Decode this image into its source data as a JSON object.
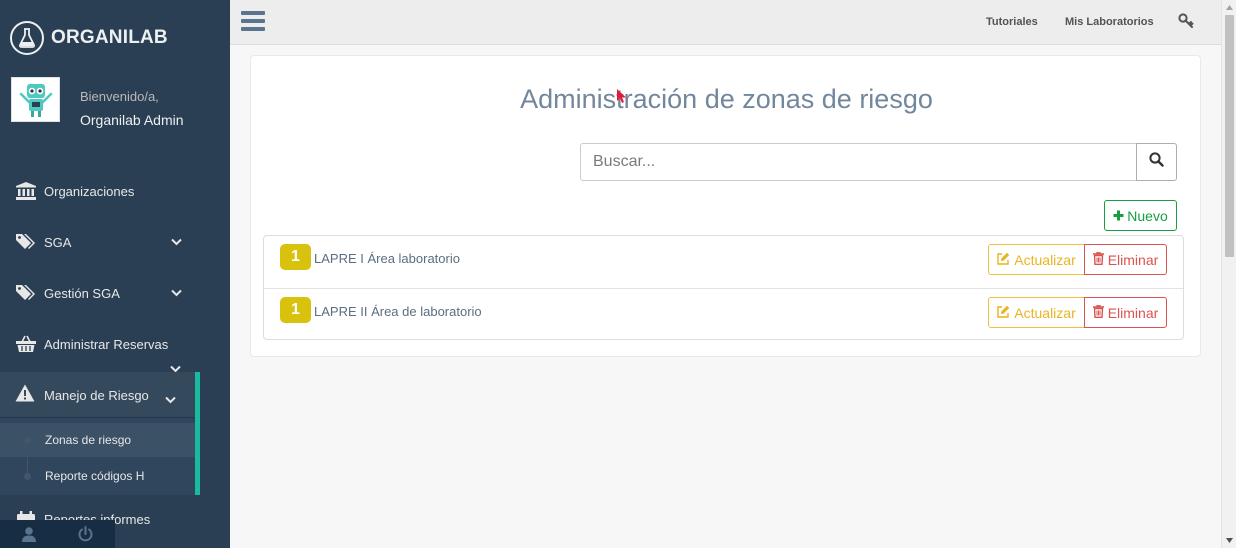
{
  "brand": {
    "name": "ORGANILAB"
  },
  "profile": {
    "welcome": "Bienvenido/a,",
    "username": "Organilab Admin"
  },
  "sidebar": {
    "items": [
      {
        "label": "Organizaciones",
        "icon": "bank-icon"
      },
      {
        "label": "SGA",
        "icon": "tags-icon"
      },
      {
        "label": "Gestión SGA",
        "icon": "tags-icon"
      },
      {
        "label": "Administrar Reservas",
        "icon": "basket-icon"
      },
      {
        "label": "Manejo de Riesgo",
        "icon": "warning-icon"
      }
    ],
    "submenu": [
      {
        "label": "Zonas de riesgo"
      },
      {
        "label": "Reporte códigos H"
      }
    ],
    "partial_item": {
      "label": "Reportes informes",
      "icon": "calendar-icon"
    },
    "accent_color": "#1abb9c"
  },
  "topnav": {
    "links": [
      {
        "label": "Tutoriales"
      },
      {
        "label": "Mis Laboratorios"
      }
    ],
    "key_icon": "key-icon"
  },
  "main": {
    "title": "Administración de zonas de riesgo",
    "search": {
      "placeholder": "Buscar...",
      "value": ""
    },
    "new_button": {
      "label": "Nuevo"
    },
    "rows": [
      {
        "badge": "1",
        "label": "LAPRE I Área laboratorio",
        "update_label": "Actualizar",
        "delete_label": "Eliminar"
      },
      {
        "badge": "1",
        "label": "LAPRE II Área de laboratorio",
        "update_label": "Actualizar",
        "delete_label": "Eliminar"
      }
    ]
  },
  "colors": {
    "sidebar_bg": "#2a3f54",
    "badge": "#d8c20e",
    "success": "#169f3f",
    "warning": "#e9b420",
    "danger": "#d9534f",
    "title": "#73879c"
  }
}
